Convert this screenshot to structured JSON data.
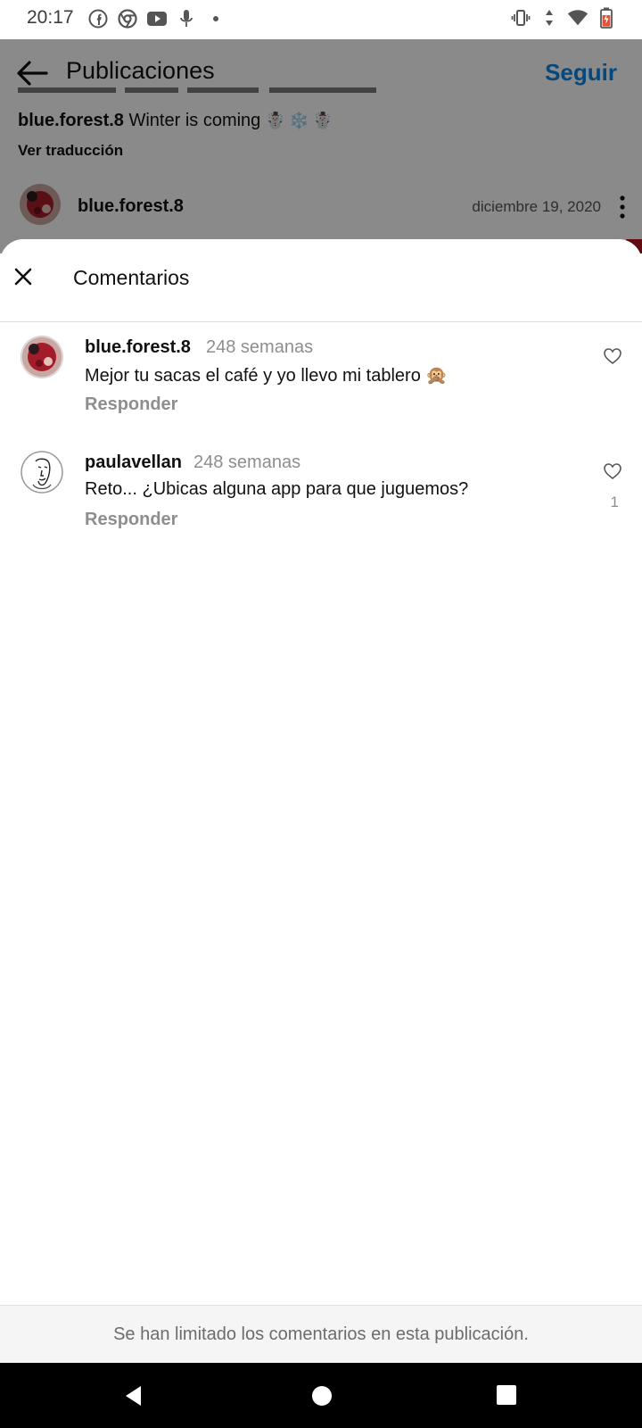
{
  "status_bar": {
    "time": "20:17",
    "left_icons": [
      "facebook-icon",
      "chrome-icon",
      "youtube-icon",
      "mic-icon",
      "dot-icon"
    ],
    "right_icons": [
      "vibrate-icon",
      "data-arrows-icon",
      "wifi-icon",
      "battery-icon"
    ]
  },
  "header": {
    "title": "Publicaciones",
    "follow_label": "Seguir"
  },
  "post": {
    "caption_user": "blue.forest.8",
    "caption_text": "Winter is coming",
    "caption_emoji": "☃️❄️☃️",
    "translate_label": "Ver traducción",
    "author": "blue.forest.8",
    "date": "diciembre 19, 2020"
  },
  "comments_sheet": {
    "title": "Comentarios",
    "comments": [
      {
        "user": "blue.forest.8",
        "time": "248 semanas",
        "text": "Mejor tu sacas el café y yo llevo mi tablero 🙊",
        "reply_label": "Responder",
        "likes": ""
      },
      {
        "user": "paulavellan",
        "time": "248 semanas",
        "text": "Reto... ¿Ubicas alguna app para que juguemos?",
        "reply_label": "Responder",
        "likes": "1"
      }
    ]
  },
  "limited_notice": "Se han limitado los comentarios en esta publicación.",
  "colors": {
    "accent": "#0a86e8",
    "muted_text": "#8e8e8e",
    "overlay": "rgba(0,0,0,0.46)"
  }
}
